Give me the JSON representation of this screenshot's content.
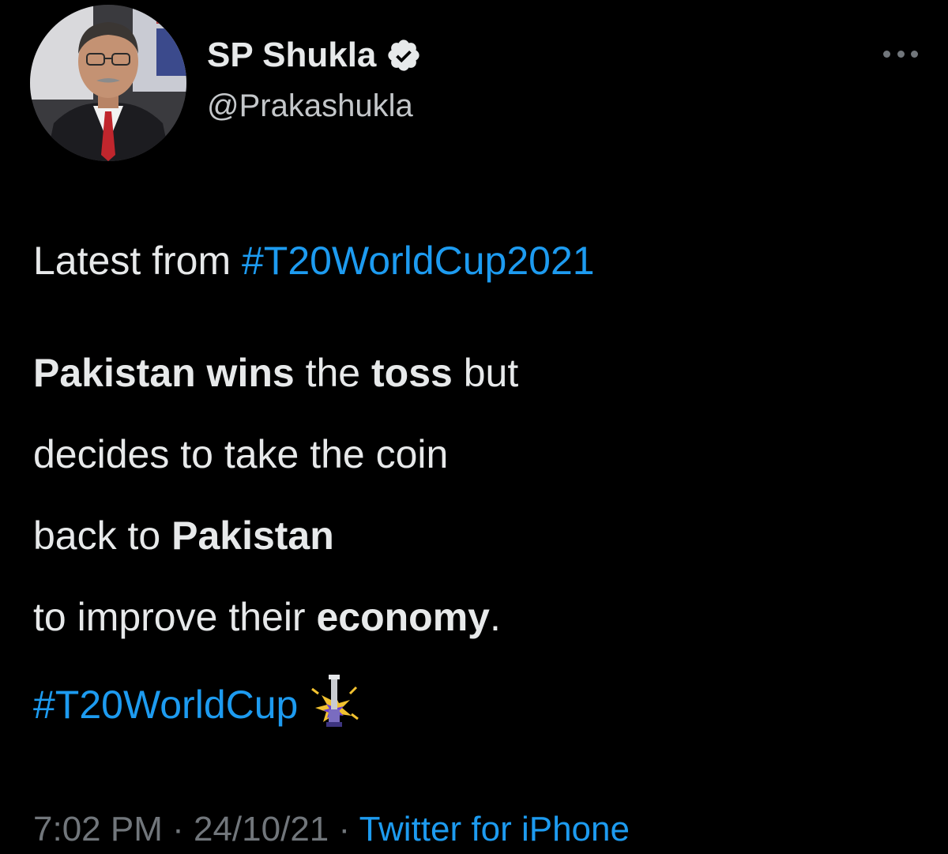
{
  "author": {
    "display_name": "SP Shukla",
    "handle": "@Prakashukla",
    "verified": true
  },
  "tweet": {
    "line1_prefix": "Latest from ",
    "line1_hashtag": "#T20WorldCup2021",
    "body_rows": [
      [
        {
          "text": "Pakistan wins",
          "style": "bold"
        },
        {
          "text": " the ",
          "style": "normal"
        },
        {
          "text": "toss",
          "style": "bold"
        },
        {
          "text": " but",
          "style": "normal"
        }
      ],
      [
        {
          "text": "decides to take the coin",
          "style": "normal"
        }
      ],
      [
        {
          "text": "back to ",
          "style": "normal"
        },
        {
          "text": "Pakistan",
          "style": "bold"
        }
      ],
      [
        {
          "text": "to improve their ",
          "style": "normal"
        },
        {
          "text": "economy",
          "style": "bold"
        },
        {
          "text": ".",
          "style": "normal"
        }
      ]
    ],
    "footer_hashtag": "#T20WorldCup",
    "footer_emoji_icon": "t20-trophy-emoji-icon"
  },
  "meta": {
    "time": "7:02 PM",
    "separator": " · ",
    "date": "24/10/21",
    "source": "Twitter for iPhone"
  },
  "colors": {
    "background": "#000000",
    "text_primary": "#e7e9ea",
    "text_secondary": "#71767b",
    "link": "#1d9bf0",
    "verified_badge": "#e7e9ea"
  },
  "icons": {
    "verified": "verified-badge-icon",
    "more": "more-dots-icon",
    "avatar": "avatar"
  }
}
